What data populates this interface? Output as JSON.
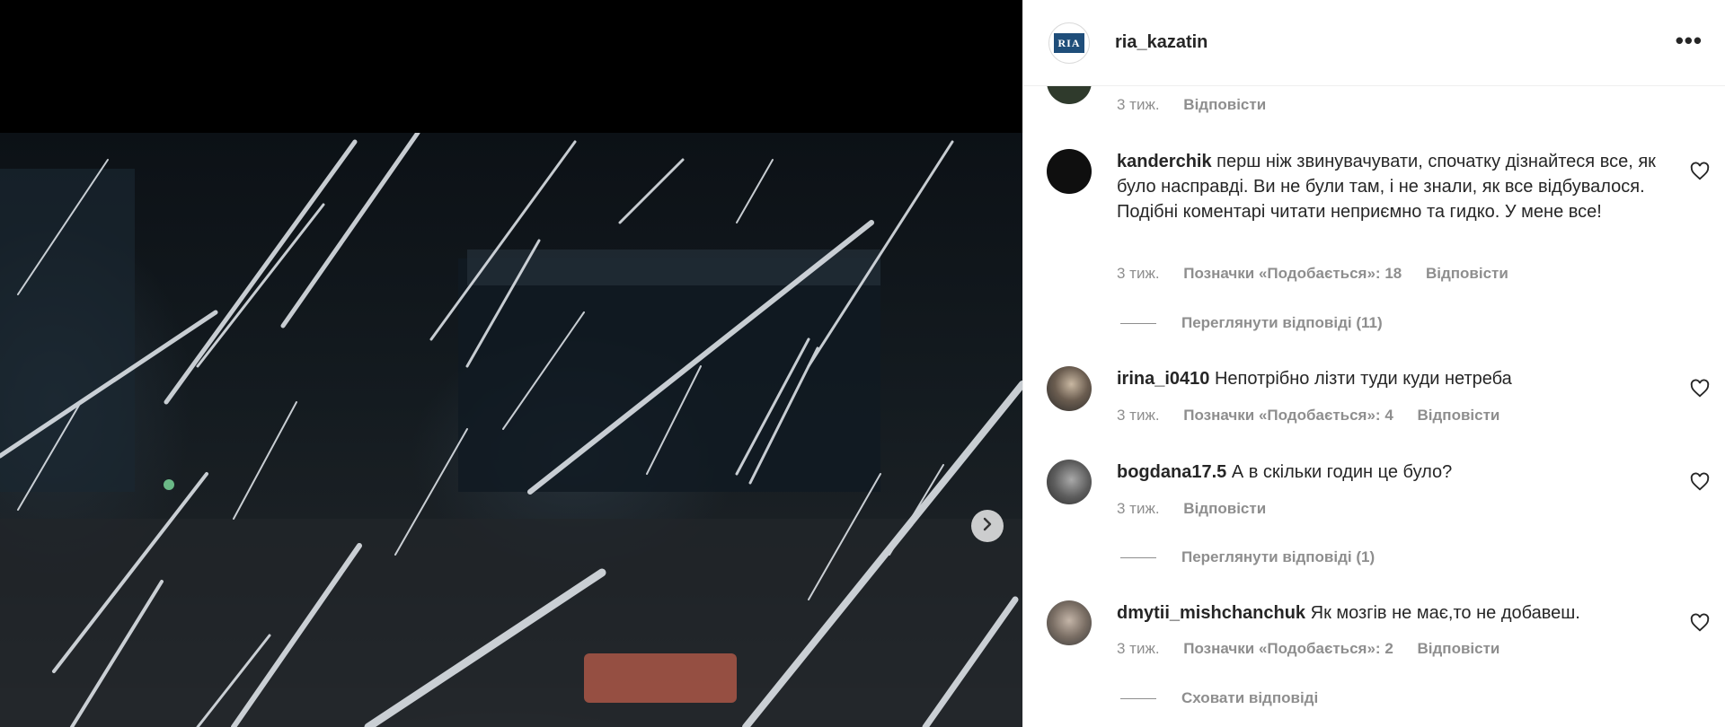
{
  "post": {
    "username": "ria_kazatin",
    "logo_text": "RIA"
  },
  "media": {
    "next_icon": "chevron-right-icon"
  },
  "comments": [
    {
      "time": "3 тиж.",
      "reply_label": "Відповісти"
    },
    {
      "username": "kanderchik",
      "text": "перш ніж звинувачувати, спочатку дізнайтеся все, як було насправді. Ви не були там, і не знали, як все відбувалося. Подібні коментарі читати неприємно та гидко. У мене все!",
      "time": "3 тиж.",
      "likes_label": "Позначки «Подобається»: 18",
      "reply_label": "Відповісти",
      "view_replies": "Переглянути відповіді (11)"
    },
    {
      "username": "irina_i0410",
      "text": "Непотрібно лізти туди куди нетреба",
      "time": "3 тиж.",
      "likes_label": "Позначки «Подобається»: 4",
      "reply_label": "Відповісти"
    },
    {
      "username": "bogdana17.5",
      "text": "А в скільки годин це було?",
      "time": "3 тиж.",
      "reply_label": "Відповісти",
      "view_replies": "Переглянути відповіді (1)"
    },
    {
      "username": "dmytii_mishchanchuk",
      "text": "Як мозгів не має,то не добавеш.",
      "time": "3 тиж.",
      "likes_label": "Позначки «Подобається»: 2",
      "reply_label": "Відповісти",
      "hide_replies": "Сховати відповіді"
    }
  ],
  "colors": {
    "text": "#262626",
    "secondary": "#8e8e8e",
    "border": "#efefef"
  }
}
